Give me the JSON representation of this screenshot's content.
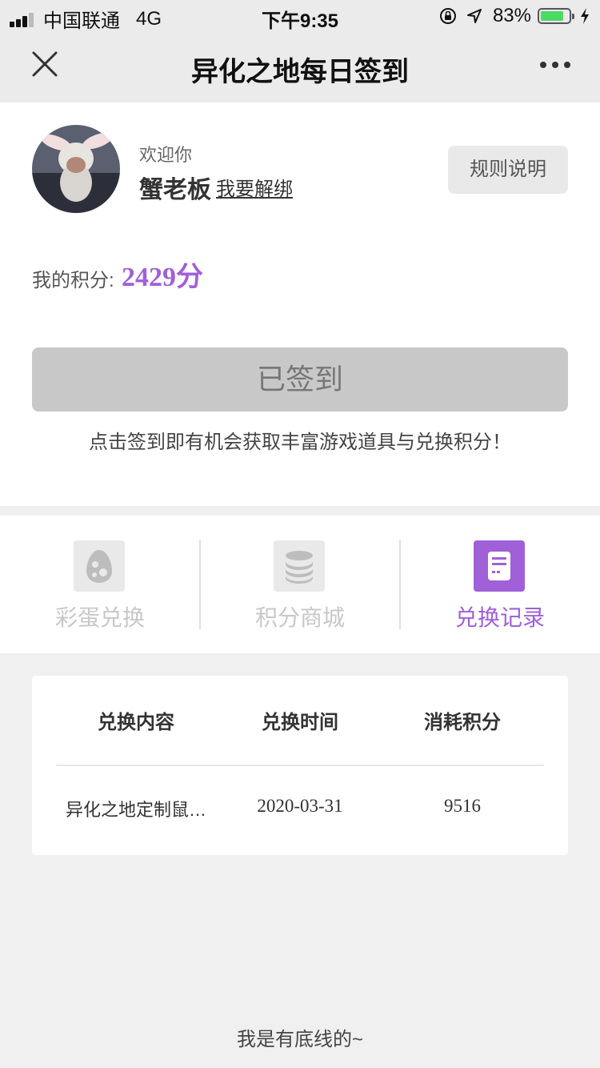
{
  "status_bar": {
    "carrier": "中国联通",
    "network": "4G",
    "time": "下午9:35",
    "battery": "83%",
    "battery_level": 0.83
  },
  "nav": {
    "title": "异化之地每日签到",
    "icons": {
      "close": "close-icon",
      "more": "more-icon"
    }
  },
  "profile": {
    "welcome": "欢迎你",
    "name": "蟹老板",
    "unbind": "我要解绑",
    "rules_button": "规则说明"
  },
  "points": {
    "label": "我的积分:",
    "value": "2429分"
  },
  "sign_in": {
    "button": "已签到",
    "hint": "点击签到即有机会获取丰富游戏道具与兑换积分！"
  },
  "tabs": [
    {
      "label": "彩蛋兑换",
      "icon": "egg-icon",
      "active": false
    },
    {
      "label": "积分商城",
      "icon": "coins-icon",
      "active": false
    },
    {
      "label": "兑换记录",
      "icon": "record-icon",
      "active": true
    }
  ],
  "records": {
    "headers": [
      "兑换内容",
      "兑换时间",
      "消耗积分"
    ],
    "rows": [
      [
        "异化之地定制鼠…",
        "2020-03-31",
        "9516"
      ]
    ]
  },
  "footer": "我是有底线的~",
  "colors": {
    "accent": "#a060d8",
    "battery": "#4cd964",
    "disabled": "#c8c8c8"
  }
}
